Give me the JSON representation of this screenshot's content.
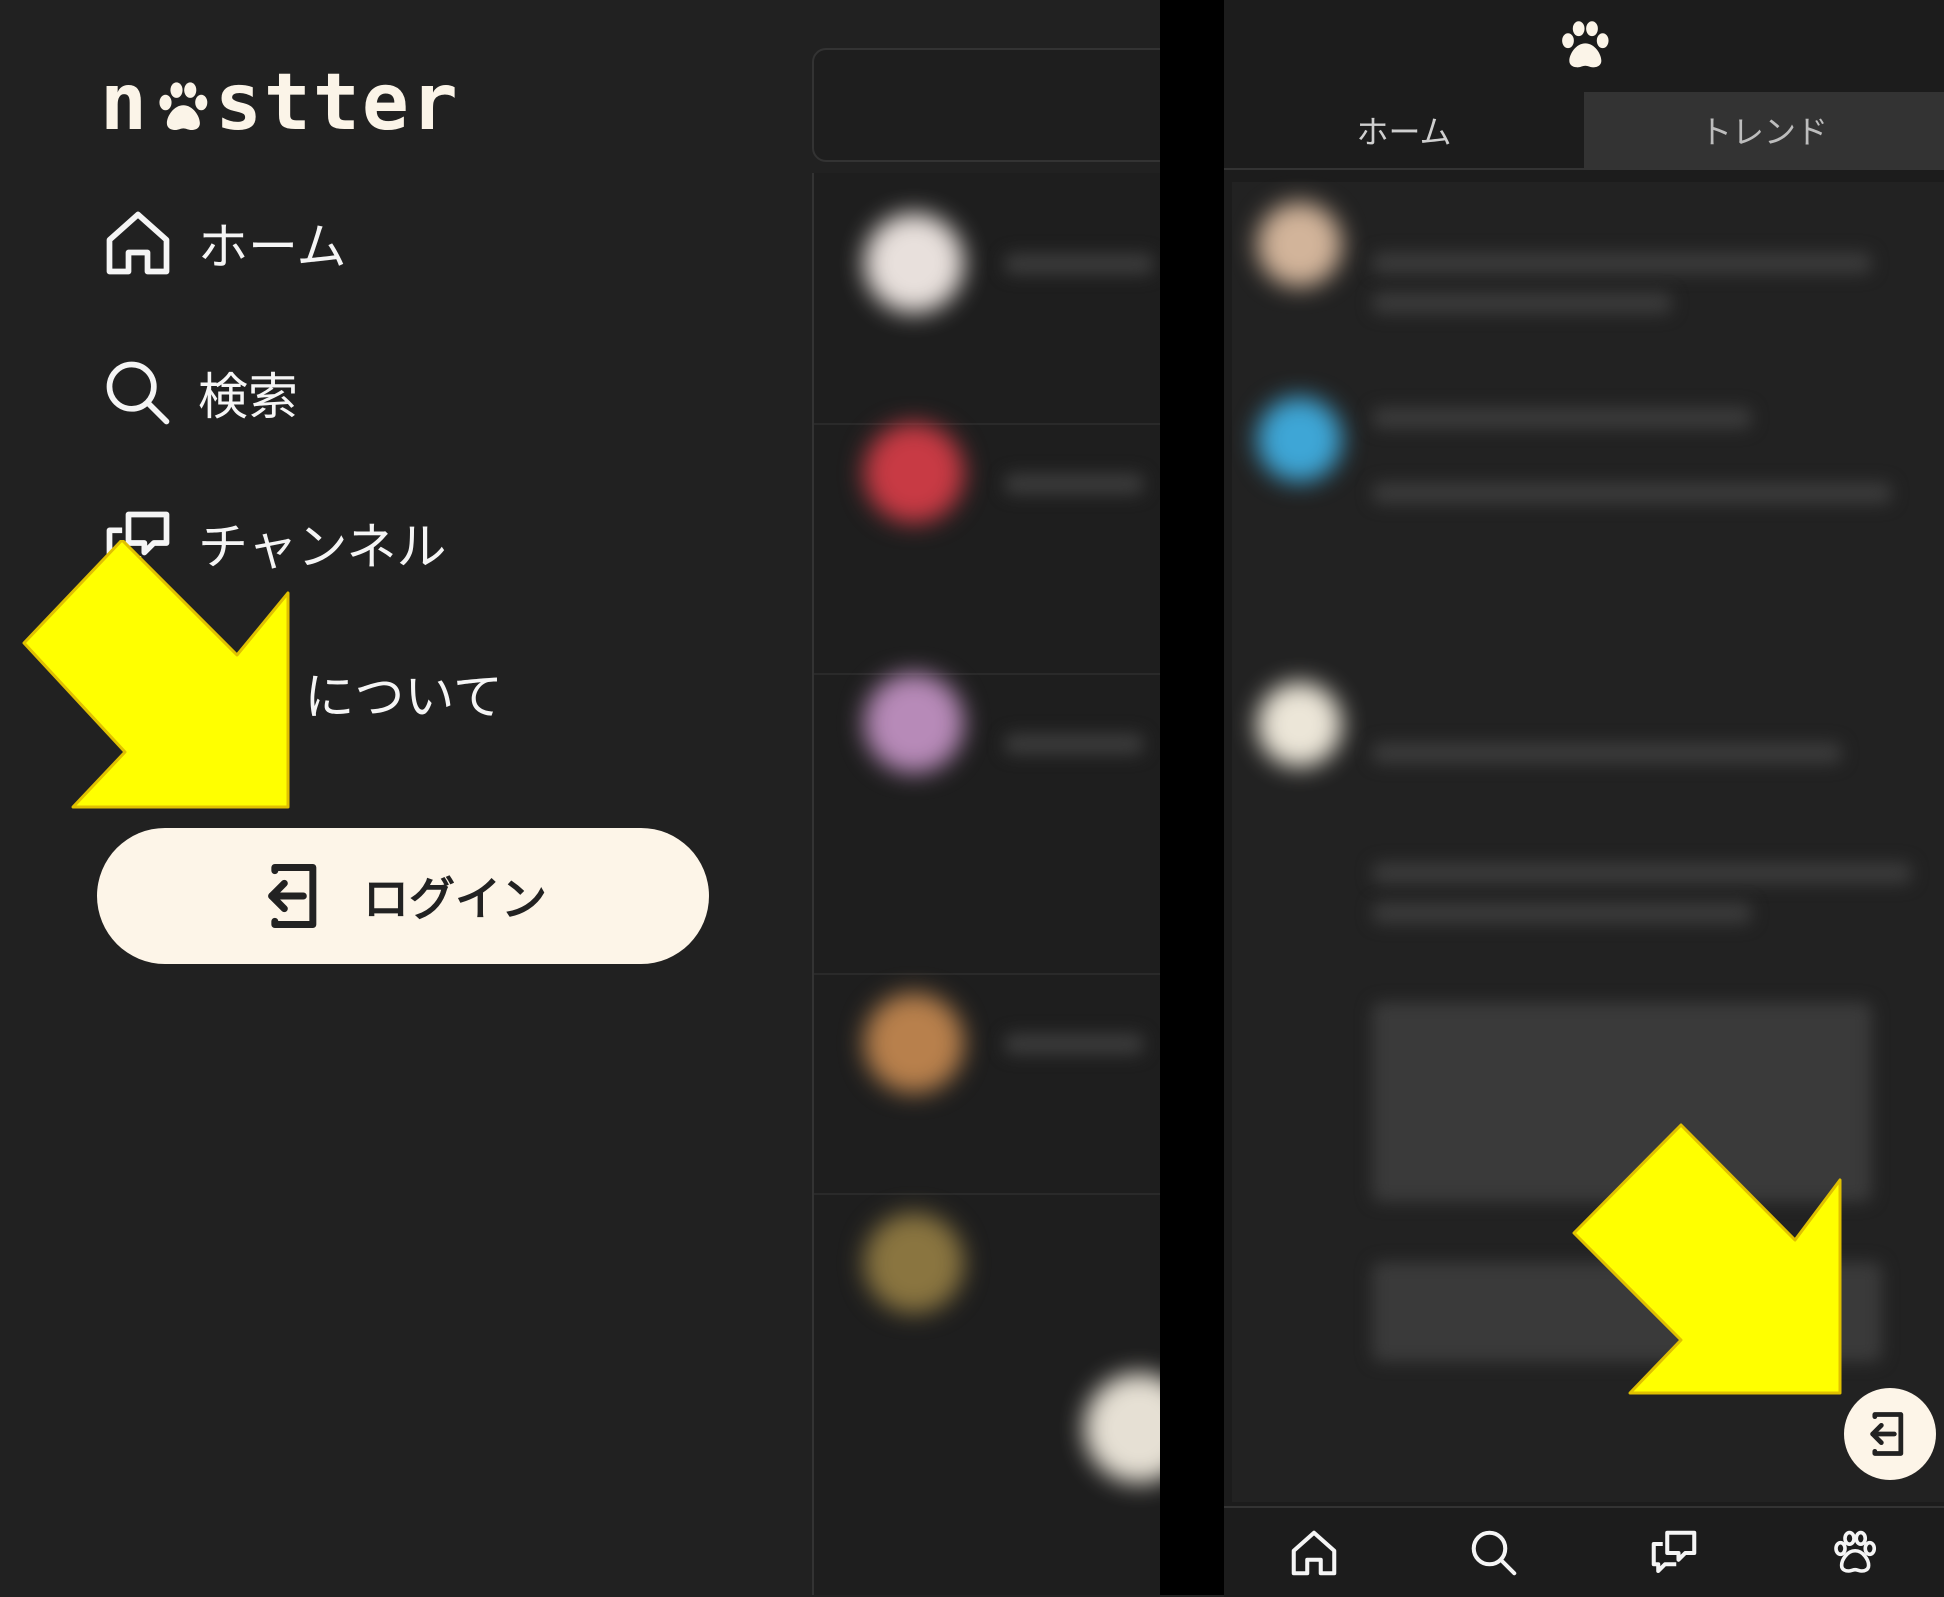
{
  "desktop": {
    "logo": {
      "prefix": "n",
      "suffix": "stter"
    },
    "nav": [
      {
        "label": "ホーム",
        "icon": "home-icon"
      },
      {
        "label": "検索",
        "icon": "search-icon"
      },
      {
        "label": "チャンネル",
        "icon": "channel-icon"
      },
      {
        "label": "tter について",
        "icon": "info-icon"
      }
    ],
    "login_label": "ログイン"
  },
  "mobile": {
    "tabs": [
      {
        "label": "ホーム",
        "active": true
      },
      {
        "label": "トレンド",
        "active": false
      }
    ],
    "bottom_nav": [
      "home-icon",
      "search-icon",
      "channel-icon",
      "paw-icon"
    ]
  },
  "colors": {
    "background": "#212121",
    "accent": "#fdf5e8",
    "arrow": "#ffff00"
  }
}
